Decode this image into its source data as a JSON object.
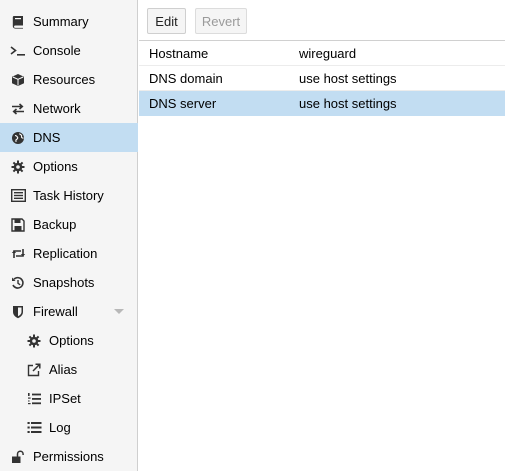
{
  "sidebar": {
    "items": [
      {
        "label": "Summary",
        "icon": "book-icon"
      },
      {
        "label": "Console",
        "icon": "terminal-icon"
      },
      {
        "label": "Resources",
        "icon": "cube-icon"
      },
      {
        "label": "Network",
        "icon": "exchange-icon"
      },
      {
        "label": "DNS",
        "icon": "globe-icon"
      },
      {
        "label": "Options",
        "icon": "gear-icon"
      },
      {
        "label": "Task History",
        "icon": "list-alt-icon"
      },
      {
        "label": "Backup",
        "icon": "floppy-icon"
      },
      {
        "label": "Replication",
        "icon": "retweet-icon"
      },
      {
        "label": "Snapshots",
        "icon": "history-icon"
      },
      {
        "label": "Firewall",
        "icon": "shield-icon"
      },
      {
        "label": "Options",
        "icon": "gear-icon"
      },
      {
        "label": "Alias",
        "icon": "external-link-icon"
      },
      {
        "label": "IPSet",
        "icon": "list-ol-icon"
      },
      {
        "label": "Log",
        "icon": "list-icon"
      },
      {
        "label": "Permissions",
        "icon": "unlock-icon"
      }
    ],
    "selected": "DNS"
  },
  "toolbar": {
    "edit_label": "Edit",
    "revert_label": "Revert"
  },
  "grid": {
    "rows": [
      {
        "key": "Hostname",
        "value": "wireguard"
      },
      {
        "key": "DNS domain",
        "value": "use host settings"
      },
      {
        "key": "DNS server",
        "value": "use host settings"
      }
    ],
    "selected_row": "DNS server"
  },
  "colors": {
    "selection": "#c2ddf2",
    "sidebar_bg": "#f5f5f5",
    "icon": "#333333"
  }
}
